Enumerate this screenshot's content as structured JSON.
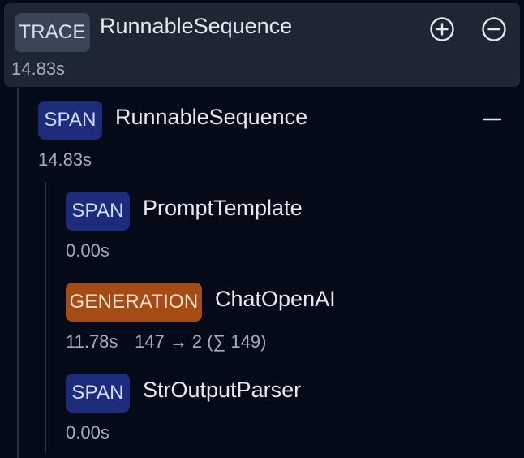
{
  "trace": {
    "badge": "TRACE",
    "name": "RunnableSequence",
    "duration": "14.83s",
    "expand_icon": "plus-circle-icon",
    "collapse_icon": "minus-circle-icon"
  },
  "root_span": {
    "badge": "SPAN",
    "name": "RunnableSequence",
    "duration": "14.83s",
    "collapse_icon": "minus-icon"
  },
  "children": [
    {
      "badge": "SPAN",
      "name": "PromptTemplate",
      "duration": "0.00s"
    },
    {
      "badge": "GENERATION",
      "name": "ChatOpenAI",
      "duration": "11.78s",
      "tokens": "147 → 2 (∑ 149)"
    },
    {
      "badge": "SPAN",
      "name": "StrOutputParser",
      "duration": "0.00s"
    }
  ],
  "colors": {
    "background": "#050a18",
    "trace_card": "#1e2633",
    "trace_badge": "#3a4557",
    "span_badge": "#1d2c7a",
    "generation_badge": "#a54b15"
  }
}
